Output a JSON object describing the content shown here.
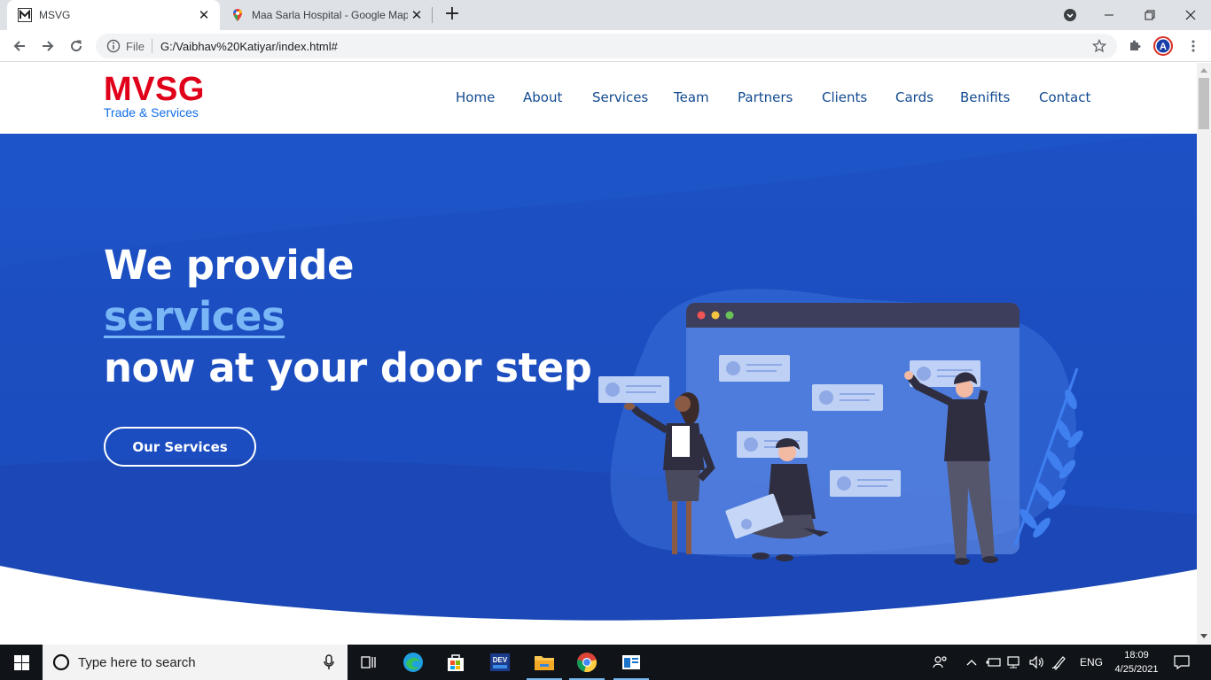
{
  "browser": {
    "tabs": [
      {
        "title": "MSVG",
        "favicon": "msvg-favicon",
        "active": true
      },
      {
        "title": "Maa Sarla Hospital - Google Maps",
        "favicon": "google-maps-icon",
        "active": false
      }
    ],
    "address": {
      "scheme": "File",
      "url": "G:/Vaibhav%20Katiyar/index.html#"
    },
    "profile_initial": "A"
  },
  "site": {
    "logo": {
      "brand": "MVSG",
      "tagline": "Trade & Services",
      "brand_color": "#e0001a",
      "tagline_color": "#106eea"
    },
    "nav": [
      {
        "label": "Home"
      },
      {
        "label": "About"
      },
      {
        "label": "Services"
      },
      {
        "label": "Team"
      },
      {
        "label": "Partners"
      },
      {
        "label": "Clients"
      },
      {
        "label": "Cards"
      },
      {
        "label": "Benifits"
      },
      {
        "label": "Contact"
      }
    ],
    "hero": {
      "line1": "We provide",
      "line2": "services",
      "line3": "now at your door step",
      "cta": "Our Services",
      "bg_color": "#1e4fc0",
      "accent_color": "#78b6f5"
    }
  },
  "taskbar": {
    "search_placeholder": "Type here to search",
    "language": "ENG",
    "time": "18:09",
    "date": "4/25/2021"
  }
}
